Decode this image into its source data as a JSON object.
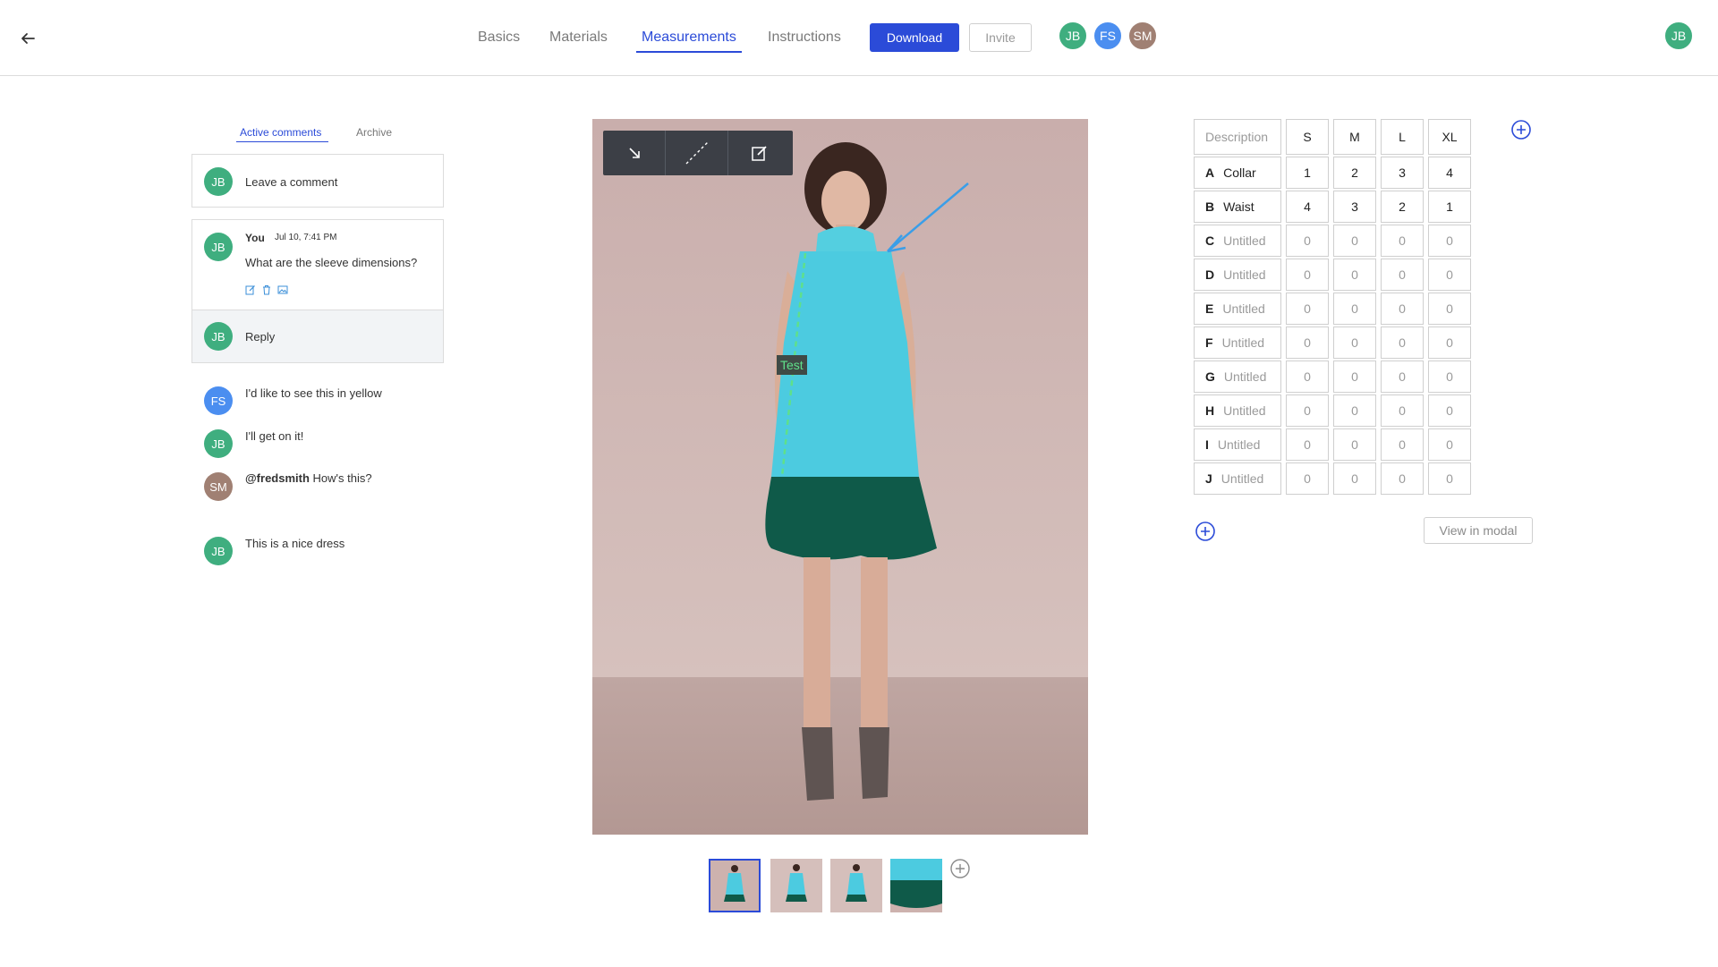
{
  "nav": {
    "tabs": [
      {
        "label": "Basics"
      },
      {
        "label": "Materials"
      },
      {
        "label": "Measurements"
      },
      {
        "label": "Instructions"
      }
    ],
    "download_label": "Download",
    "invite_label": "Invite",
    "collaborators": [
      "JB",
      "FS",
      "SM"
    ],
    "user_initials": "JB"
  },
  "comments": {
    "tabs": [
      {
        "label": "Active comments"
      },
      {
        "label": "Archive"
      }
    ],
    "new_comment": {
      "avatar": "JB",
      "placeholder": "Leave a comment"
    },
    "thread": {
      "avatar": "JB",
      "author": "You",
      "timestamp": "Jul 10, 7:41 PM",
      "text": "What are the sleeve dimensions?",
      "reply_avatar": "JB",
      "reply_placeholder": "Reply"
    },
    "list": [
      {
        "avatar": "FS",
        "mention": "",
        "text": "I'd like to see this in yellow"
      },
      {
        "avatar": "JB",
        "mention": "",
        "text": "I'll get on it!"
      },
      {
        "avatar": "SM",
        "mention": "@fredsmith",
        "text": "How's this?"
      },
      {
        "avatar": "JB",
        "mention": "",
        "text": "This is a nice dress"
      }
    ]
  },
  "image_panel": {
    "annotation_label": "Test",
    "tools": [
      "arrow-tool-icon",
      "dashed-line-tool-icon",
      "edit-tool-icon"
    ],
    "thumbnail_count": 4,
    "selected_thumbnail": 1
  },
  "measurements": {
    "headers": [
      "Description",
      "S",
      "M",
      "L",
      "XL"
    ],
    "rows": [
      {
        "letter": "A",
        "name": "Collar",
        "values": [
          "1",
          "2",
          "3",
          "4"
        ]
      },
      {
        "letter": "B",
        "name": "Waist",
        "values": [
          "4",
          "3",
          "2",
          "1"
        ]
      },
      {
        "letter": "C",
        "name": "Untitled",
        "values": [
          "0",
          "0",
          "0",
          "0"
        ]
      },
      {
        "letter": "D",
        "name": "Untitled",
        "values": [
          "0",
          "0",
          "0",
          "0"
        ]
      },
      {
        "letter": "E",
        "name": "Untitled",
        "values": [
          "0",
          "0",
          "0",
          "0"
        ]
      },
      {
        "letter": "F",
        "name": "Untitled",
        "values": [
          "0",
          "0",
          "0",
          "0"
        ]
      },
      {
        "letter": "G",
        "name": "Untitled",
        "values": [
          "0",
          "0",
          "0",
          "0"
        ]
      },
      {
        "letter": "H",
        "name": "Untitled",
        "values": [
          "0",
          "0",
          "0",
          "0"
        ]
      },
      {
        "letter": "I",
        "name": "Untitled",
        "values": [
          "0",
          "0",
          "0",
          "0"
        ]
      },
      {
        "letter": "J",
        "name": "Untitled",
        "values": [
          "0",
          "0",
          "0",
          "0"
        ]
      }
    ],
    "view_modal_label": "View in modal"
  },
  "colors": {
    "accent": "#2b4bd8",
    "avatar_green": "#3fae7f",
    "avatar_blue": "#4b8ef0",
    "avatar_brown": "#a08073"
  }
}
